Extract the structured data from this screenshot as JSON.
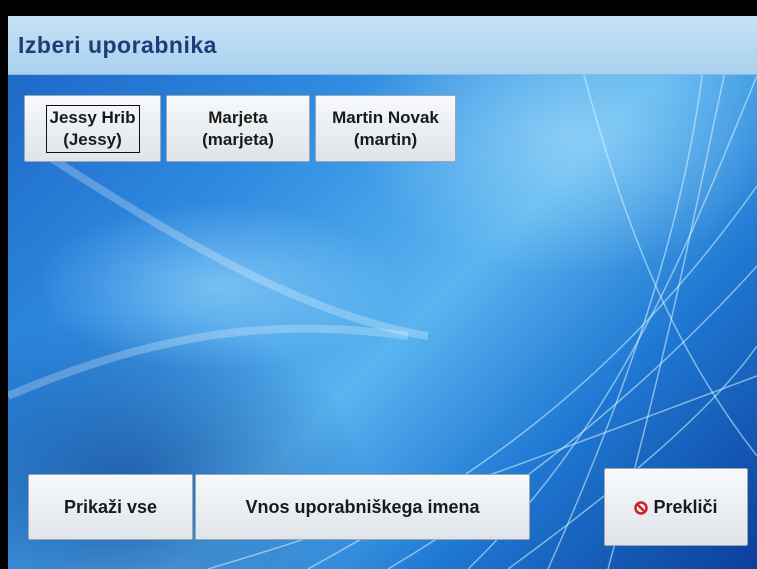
{
  "header": {
    "title": "Izberi uporabnika"
  },
  "users": [
    {
      "name": "Jessy Hrib",
      "username": "(Jessy)"
    },
    {
      "name": "Marjeta",
      "username": "(marjeta)"
    },
    {
      "name": "Martin Novak",
      "username": "(martin)"
    }
  ],
  "footer": {
    "show_all_label": "Prikaži vse",
    "enter_username_label": "Vnos uporabniškega imena",
    "cancel_label": "Prekliči"
  },
  "colors": {
    "title_text": "#1f3c78",
    "cancel_icon": "#d0202a"
  },
  "icons": {
    "cancel": "no-entry-icon"
  }
}
